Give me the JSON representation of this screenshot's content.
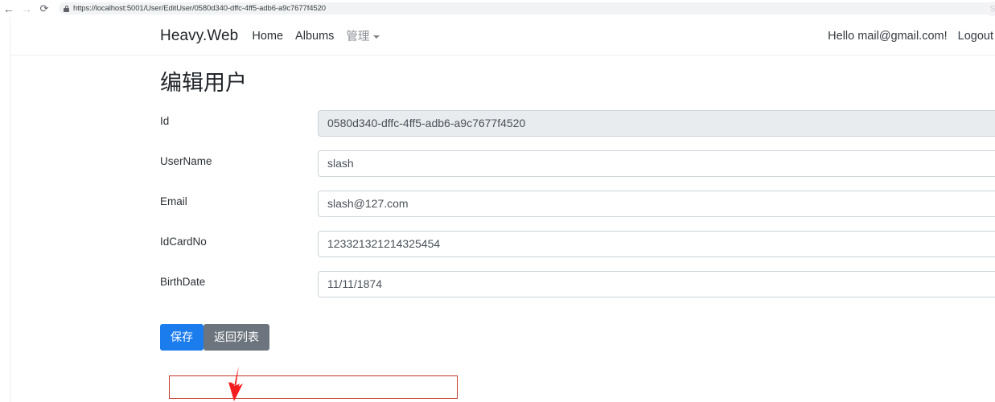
{
  "browser": {
    "back_icon": "back-arrow-icon",
    "forward_icon": "forward-arrow-icon",
    "reload_icon": "reload-icon",
    "lock_icon": "lock-icon",
    "url": "https://localhost:5001/User/EditUser/0580d340-dffc-4ff5-adb6-a9c7677f4520",
    "back_glyph": "←",
    "forward_glyph": "→",
    "reload_glyph": "⟳",
    "avatar_glyph": "S"
  },
  "navbar": {
    "brand": "Heavy.Web",
    "links": [
      {
        "label": "Home"
      },
      {
        "label": "Albums"
      },
      {
        "label": "管理",
        "has_caret": true
      }
    ],
    "greeting": "Hello mail@gmail.com!",
    "logout": "Logout"
  },
  "main": {
    "title": "编辑用户",
    "fields": [
      {
        "label": "Id",
        "value": "0580d340-dffc-4ff5-adb6-a9c7677f4520",
        "disabled": true
      },
      {
        "label": "UserName",
        "value": "slash",
        "disabled": false
      },
      {
        "label": "Email",
        "value": "slash@127.com",
        "disabled": false
      },
      {
        "label": "IdCardNo",
        "value": "123321321214325454",
        "disabled": false
      },
      {
        "label": "BirthDate",
        "value": "11/11/1874",
        "disabled": false
      }
    ],
    "buttons": {
      "save": "保存",
      "back_to_list": "返回列表"
    }
  },
  "annotation": {
    "arrow_color": "#ff1a1a",
    "box_color": "#c0392b"
  },
  "colors": {
    "primary": "#1b7ced",
    "secondary": "#6c757d",
    "disabled_bg": "#e9ecef",
    "border": "#ced4da"
  }
}
